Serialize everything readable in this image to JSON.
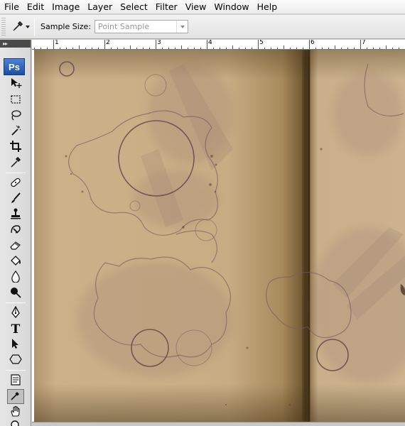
{
  "menu": [
    "File",
    "Edit",
    "Image",
    "Layer",
    "Select",
    "Filter",
    "View",
    "Window",
    "Help"
  ],
  "options": {
    "sample_size_label": "Sample Size:",
    "sample_size_value": "Point Sample"
  },
  "toolbox": {
    "logo": "Ps",
    "tools": [
      {
        "name": "move-tool-icon"
      },
      {
        "name": "marquee-tool-icon"
      },
      {
        "name": "lasso-tool-icon"
      },
      {
        "name": "magic-wand-tool-icon"
      },
      {
        "name": "crop-tool-icon"
      },
      {
        "name": "slice-tool-icon"
      },
      {
        "name": "healing-brush-tool-icon"
      },
      {
        "name": "brush-tool-icon"
      },
      {
        "name": "clone-stamp-tool-icon"
      },
      {
        "name": "history-brush-tool-icon"
      },
      {
        "name": "eraser-tool-icon"
      },
      {
        "name": "paint-bucket-tool-icon"
      },
      {
        "name": "blur-tool-icon"
      },
      {
        "name": "dodge-tool-icon"
      },
      {
        "name": "pen-tool-icon"
      },
      {
        "name": "type-tool-icon"
      },
      {
        "name": "path-selection-tool-icon"
      },
      {
        "name": "shape-tool-icon"
      },
      {
        "name": "notes-tool-icon"
      },
      {
        "name": "eyedropper-tool-icon"
      },
      {
        "name": "hand-tool-icon"
      },
      {
        "name": "zoom-tool-icon"
      }
    ],
    "type_glyph": "T"
  },
  "ruler": {
    "labels": [
      "1",
      "2",
      "3",
      "4",
      "5",
      "6",
      "7"
    ]
  },
  "colors": {
    "paper": "#c9ad83",
    "stain": "#7a5a5e",
    "fold_shadow": "#4a3a20",
    "logo": "#2a5fb8"
  }
}
